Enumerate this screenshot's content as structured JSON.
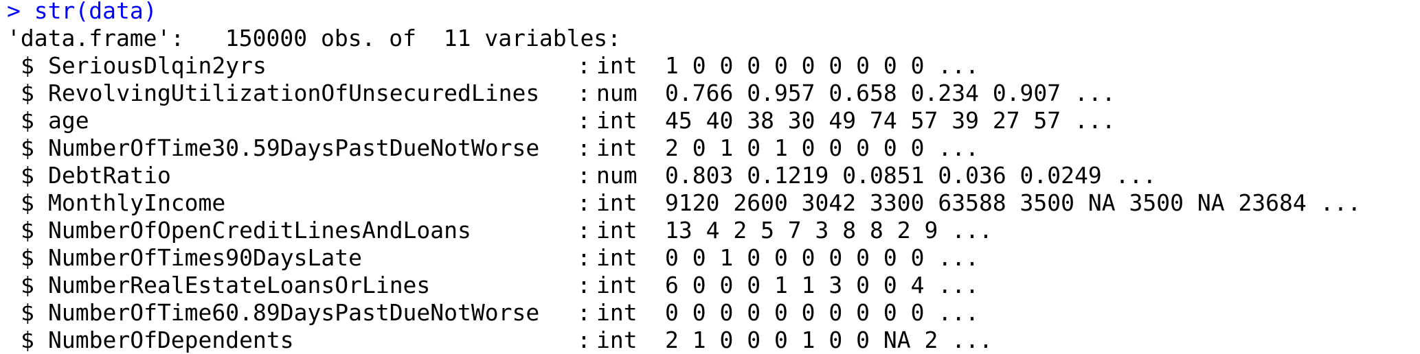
{
  "console": {
    "prompt": ">",
    "command": "str(data)",
    "header": "'data.frame':   150000 obs. of  11 variables:",
    "variables": [
      {
        "marker": "$",
        "name": "SeriousDlqin2yrs",
        "sep": ":",
        "type": "int",
        "values": "1 0 0 0 0 0 0 0 0 0 ..."
      },
      {
        "marker": "$",
        "name": "RevolvingUtilizationOfUnsecuredLines",
        "sep": ":",
        "type": "num",
        "values": "0.766 0.957 0.658 0.234 0.907 ..."
      },
      {
        "marker": "$",
        "name": "age",
        "sep": ":",
        "type": "int",
        "values": "45 40 38 30 49 74 57 39 27 57 ..."
      },
      {
        "marker": "$",
        "name": "NumberOfTime30.59DaysPastDueNotWorse",
        "sep": ":",
        "type": "int",
        "values": "2 0 1 0 1 0 0 0 0 0 ..."
      },
      {
        "marker": "$",
        "name": "DebtRatio",
        "sep": ":",
        "type": "num",
        "values": "0.803 0.1219 0.0851 0.036 0.0249 ..."
      },
      {
        "marker": "$",
        "name": "MonthlyIncome",
        "sep": ":",
        "type": "int",
        "values": "9120 2600 3042 3300 63588 3500 NA 3500 NA 23684 ..."
      },
      {
        "marker": "$",
        "name": "NumberOfOpenCreditLinesAndLoans",
        "sep": ":",
        "type": "int",
        "values": "13 4 2 5 7 3 8 8 2 9 ..."
      },
      {
        "marker": "$",
        "name": "NumberOfTimes90DaysLate",
        "sep": ":",
        "type": "int",
        "values": "0 0 1 0 0 0 0 0 0 0 ..."
      },
      {
        "marker": "$",
        "name": "NumberRealEstateLoansOrLines",
        "sep": ":",
        "type": "int",
        "values": "6 0 0 0 1 1 3 0 0 4 ..."
      },
      {
        "marker": "$",
        "name": "NumberOfTime60.89DaysPastDueNotWorse",
        "sep": ":",
        "type": "int",
        "values": "0 0 0 0 0 0 0 0 0 0 ..."
      },
      {
        "marker": "$",
        "name": "NumberOfDependents",
        "sep": ":",
        "type": "int",
        "values": "2 1 0 0 0 1 0 0 NA 2 ..."
      }
    ]
  }
}
